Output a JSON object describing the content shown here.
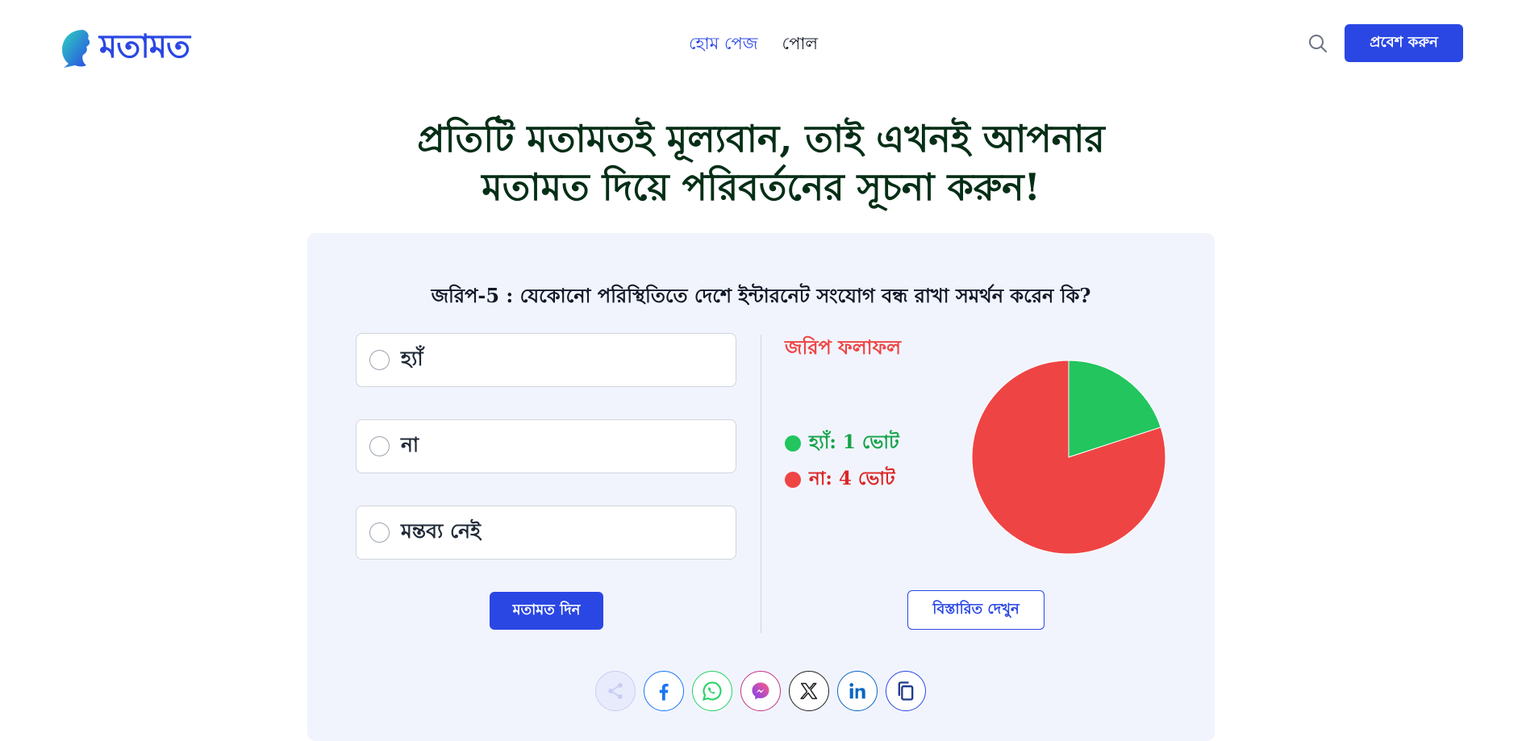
{
  "header": {
    "logo_text": "মতামত",
    "nav": [
      {
        "label": "হোম পেজ",
        "active": true
      },
      {
        "label": "পোল",
        "active": false
      }
    ],
    "login_label": "প্রবেশ করুন"
  },
  "hero": {
    "line1": "প্রতিটি মতামতই মূল্যবান, তাই এখনই আপনার",
    "line2": "মতামত দিয়ে পরিবর্তনের সূচনা করুন!"
  },
  "poll": {
    "question": "জরিপ-5 : যেকোনো পরিস্থিতিতে দেশে ইন্টারনেট সংযোগ বন্ধ রাখা সমর্থন করেন কি?",
    "options": [
      {
        "label": "হ্যাঁ"
      },
      {
        "label": "না"
      },
      {
        "label": "মন্তব্য নেই"
      }
    ],
    "submit_label": "মতামত দিন"
  },
  "results": {
    "title": "জরিপ ফলাফল",
    "items": [
      {
        "label": "হ্যাঁ: 1 ভোট",
        "color": "#22c55e",
        "text_color": "#16a34a"
      },
      {
        "label": "না: 4 ভোট",
        "color": "#ef4444",
        "text_color": "#dc2626"
      }
    ],
    "details_label": "বিস্তারিত দেখুন"
  },
  "chart_data": {
    "type": "pie",
    "categories": [
      "হ্যাঁ",
      "না"
    ],
    "values": [
      1,
      4
    ],
    "colors": [
      "#22c55e",
      "#ef4444"
    ]
  },
  "share": {
    "icons": [
      "share-icon",
      "facebook-icon",
      "whatsapp-icon",
      "messenger-icon",
      "x-icon",
      "linkedin-icon",
      "copy-icon"
    ]
  },
  "colors": {
    "brand": "#2a47e4",
    "card_bg": "#f1f4fd",
    "hero_text": "#052e16"
  }
}
